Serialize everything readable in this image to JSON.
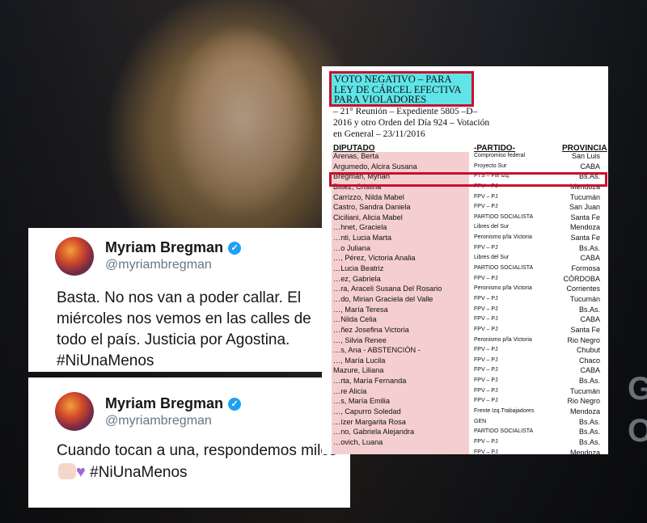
{
  "tweets": [
    {
      "name": "Myriam Bregman",
      "handle": "@myriambregman",
      "text": "Basta. No nos van a poder callar. El miércoles nos vemos en las calles de todo el país. Justicia por Agostina. #NiUnaMenos"
    },
    {
      "name": "Myriam Bregman",
      "handle": "@myriambregman",
      "text_before": "Cuando tocan a una, respondemos miles",
      "text_after": "#NiUnaMenos"
    }
  ],
  "background_letters": [
    "G",
    "O"
  ],
  "document": {
    "title": "VOTO NEGATIVO – PARA LEY DE CÁRCEL EFECTIVA PARA VIOLADORES",
    "subtitle": "– 21° Reunión – Expediente 5805 –D– 2016 y otro Orden del Día 924 – Votación en General – 23/11/2016",
    "headers": {
      "diputado": "DIPUTADO",
      "partido": "-PARTIDO-",
      "provincia": "PROVINCIA"
    },
    "rows": [
      [
        "Arenas, Berta",
        "Compromiso federal",
        "San Luis"
      ],
      [
        "Argumedo, Alcira Susana",
        "Proyecto Sur",
        "CABA"
      ],
      [
        "Bregman, Myrian",
        "PTS – Fte Izq.",
        "Bs.As."
      ],
      [
        "Bittez, Cristina",
        "FPV – PJ",
        "Mendoza"
      ],
      [
        "Carrizzo, Nilda Mabel",
        "FPV – PJ",
        "Tucumán"
      ],
      [
        "Castro, Sandra Daniela",
        "FPV – PJ",
        "San Juan"
      ],
      [
        "Ciciliani, Alicia Mabel",
        "PARTIDO SOCIALISTA",
        "Santa Fe"
      ],
      [
        "…hnet, Graciela",
        "Libres del Sur",
        "Mendoza"
      ],
      [
        "…nti, Lucia Marta",
        "Peronismo p/la Victoria",
        "Santa Fe"
      ],
      [
        "…o Juliana",
        "FPV – PJ",
        "Bs.As."
      ],
      [
        "…, Pérez, Victoria Analia",
        "Libres del Sur",
        "CABA"
      ],
      [
        "…Lucia Beatriz",
        "PARTIDO SOCIALISTA",
        "Formosa"
      ],
      [
        "…ez, Gabriela",
        "FPV – PJ",
        "CÓRDOBA"
      ],
      [
        "…ra, Araceli Susana Del Rosario",
        "Peronismo p/la Victoria",
        "Corrientes"
      ],
      [
        "…do, Mirian Graciela del Valle",
        "FPV – PJ",
        "Tucumán"
      ],
      [
        "…, María Teresa",
        "FPV – PJ",
        "Bs.As."
      ],
      [
        "…Nilda Celia",
        "FPV – PJ",
        "CABA"
      ],
      [
        "…ñez Josefina Victoria",
        "FPV – PJ",
        "Santa Fe"
      ],
      [
        "…, Silvia Renee",
        "Peronismo p/la Victoria",
        "Rio Negro"
      ],
      [
        "…s, Ana - ABSTENCIÓN -",
        "FPV – PJ",
        "Chubut"
      ],
      [
        "…, María Lucila",
        "FPV – PJ",
        "Chaco"
      ],
      [
        "Mazure, Liliana",
        "FPV – PJ",
        "CABA"
      ],
      [
        "…rta, María Fernanda",
        "FPV – PJ",
        "Bs.As."
      ],
      [
        "…re Alicia",
        "FPV – PJ",
        "Tucumán"
      ],
      [
        "…s, María Emilia",
        "FPV – PJ",
        "Rio Negro"
      ],
      [
        "…, Capurro Soledad",
        "Frente Izq.Trabajadores",
        "Mendoza"
      ],
      [
        "…ízer Margarita Rosa",
        "GEN",
        "Bs.As."
      ],
      [
        "…no, Gabriela Alejandra",
        "PARTIDO SOCIALISTA",
        "Bs.As."
      ],
      [
        "…ovich, Luana",
        "FPV – PJ",
        "Bs.As."
      ],
      [
        "…",
        "FPV – PJ",
        "Mendoza"
      ]
    ]
  }
}
